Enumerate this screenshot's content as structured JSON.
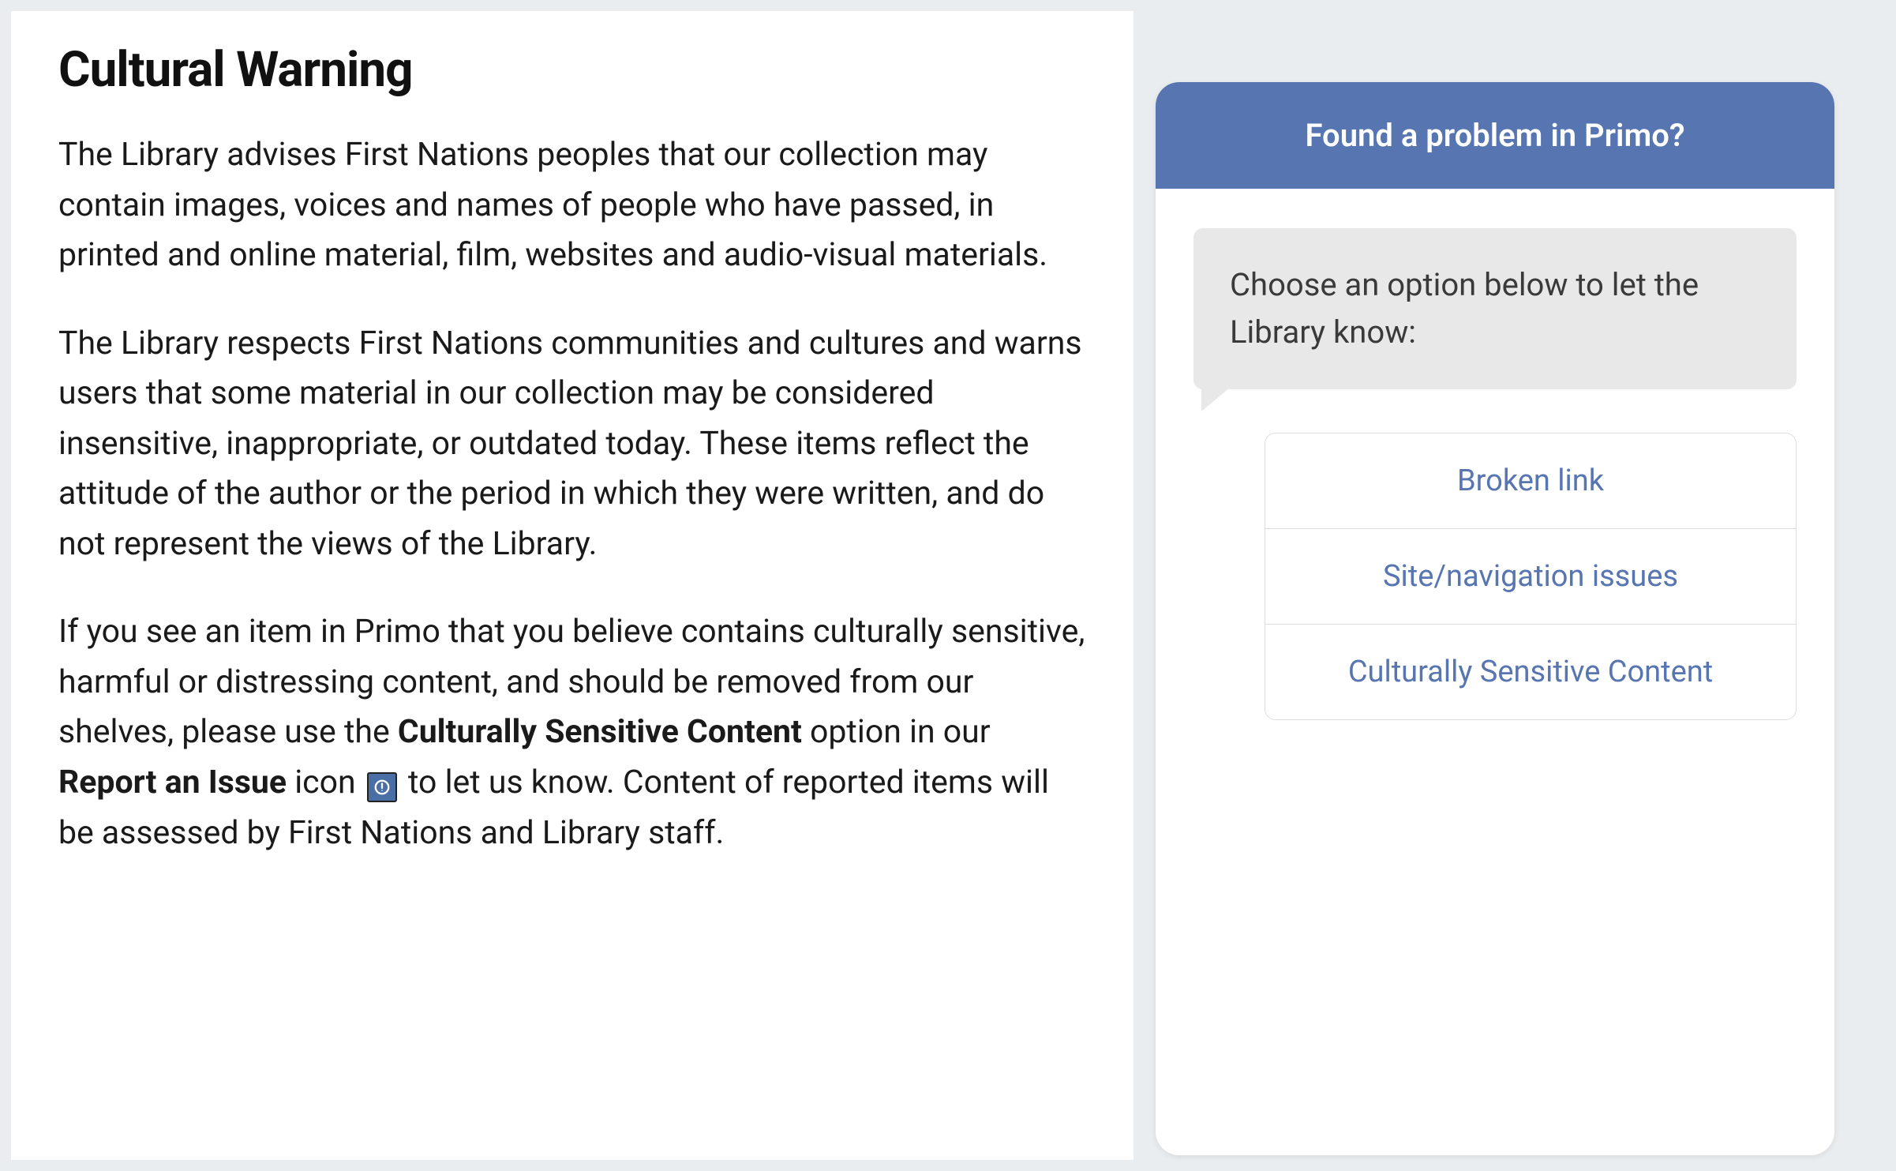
{
  "warning": {
    "title": "Cultural Warning",
    "p1": "The Library advises First Nations peoples that our collection may contain images, voices and names of people who have passed, in printed and online material, film, websites and audio-visual materials.",
    "p2": "The Library respects First Nations communities and cultures and warns users that some material in our collection may be considered insensitive, inappropriate, or outdated today. These items reflect the attitude of the author or the period in which they were written, and do not represent the views of the Library.",
    "p3_a": "If you see an item in Primo that you believe contains culturally sensitive, harmful or distressing content, and should be removed from our shelves, please use the ",
    "p3_bold1": "Culturally Sensitive Content",
    "p3_b": " option in our ",
    "p3_bold2": "Report an Issue",
    "p3_c": " icon ",
    "p3_d": " to let us know. Content of reported items will be assessed by First Nations and Library staff."
  },
  "chat": {
    "header": "Found a problem in Primo?",
    "prompt": "Choose an option below to let the Library know:",
    "options": [
      "Broken link",
      "Site/navigation issues",
      "Culturally Sensitive Content"
    ]
  },
  "icons": {
    "report_issue": "alert-circle-icon"
  },
  "colors": {
    "accent": "#5775b0",
    "bubble_bg": "#e8e8e8",
    "page_bg": "#e9edef"
  }
}
